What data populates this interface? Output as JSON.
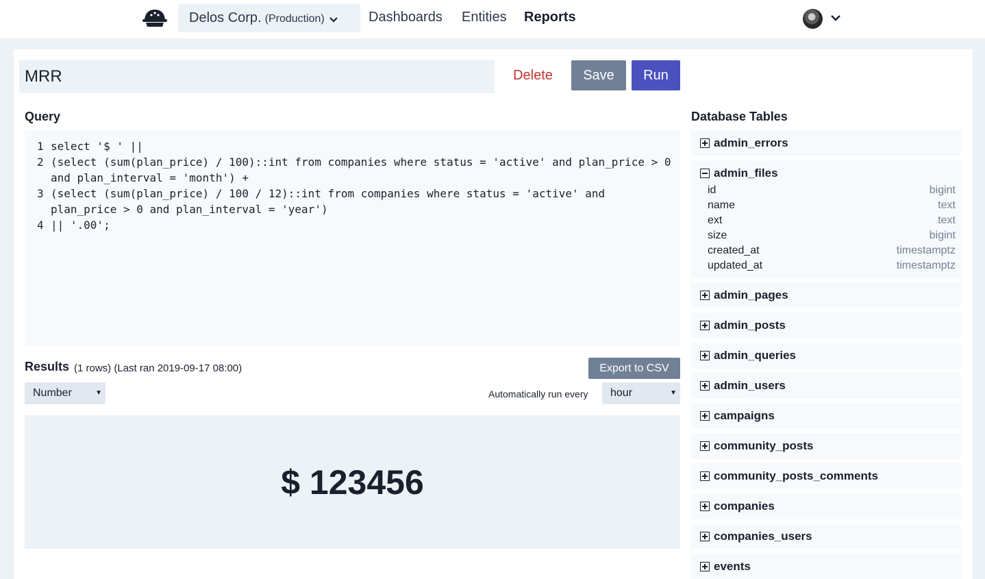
{
  "nav": {
    "org_name": "Delos Corp.",
    "org_env": "(Production)",
    "links": [
      "Dashboards",
      "Entities",
      "Reports"
    ]
  },
  "report": {
    "title": "MRR",
    "delete_label": "Delete",
    "save_label": "Save",
    "run_label": "Run"
  },
  "query": {
    "heading": "Query",
    "lines": [
      "select '$ ' ||",
      "(select (sum(plan_price) / 100)::int from companies where status = 'active' and plan_price > 0 and plan_interval = 'month') +",
      "(select (sum(plan_price) / 100 / 12)::int from companies where status = 'active' and plan_price > 0 and plan_interval = 'year')",
      "|| '.00';"
    ],
    "line_numbers": [
      "1",
      "2",
      "3",
      "4"
    ]
  },
  "results": {
    "heading": "Results",
    "meta": "(1 rows) (Last ran 2019-09-17 08:00)",
    "export_label": "Export to CSV",
    "display_type": "Number",
    "auto_run_label": "Automatically run every",
    "auto_run_value": "hour",
    "value": "$ 123456"
  },
  "db": {
    "heading": "Database Tables",
    "tables": [
      {
        "name": "admin_errors"
      },
      {
        "name": "admin_files",
        "columns": [
          {
            "name": "id",
            "type": "bigint"
          },
          {
            "name": "name",
            "type": "text"
          },
          {
            "name": "ext",
            "type": "text"
          },
          {
            "name": "size",
            "type": "bigint"
          },
          {
            "name": "created_at",
            "type": "timestamptz"
          },
          {
            "name": "updated_at",
            "type": "timestamptz"
          }
        ]
      },
      {
        "name": "admin_pages"
      },
      {
        "name": "admin_posts"
      },
      {
        "name": "admin_queries"
      },
      {
        "name": "admin_users"
      },
      {
        "name": "campaigns"
      },
      {
        "name": "community_posts"
      },
      {
        "name": "community_posts_comments"
      },
      {
        "name": "companies"
      },
      {
        "name": "companies_users"
      },
      {
        "name": "events"
      }
    ]
  }
}
